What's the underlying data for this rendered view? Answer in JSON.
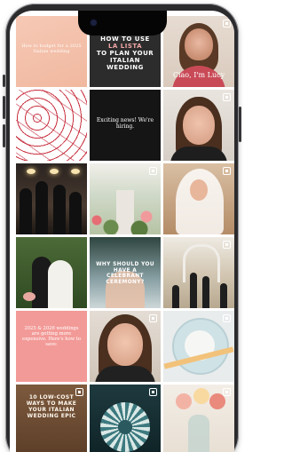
{
  "feed": {
    "posts": [
      {
        "overlay_text": "How to budget for a 2025 Italian wedding",
        "is_carousel": false
      },
      {
        "overlay_text_parts": [
          "HOW TO USE",
          "LA LISTA",
          "TO PLAN YOUR ITALIAN WEDDING"
        ],
        "is_carousel": true
      },
      {
        "overlay_text": "Ciao, I'm Lucy",
        "is_carousel": true
      },
      {
        "overlay_text": "",
        "is_carousel": false
      },
      {
        "overlay_text": "Exciting news! We're hiring.",
        "is_carousel": false
      },
      {
        "overlay_text": "",
        "is_carousel": true
      },
      {
        "overlay_text": "",
        "is_carousel": false
      },
      {
        "overlay_text": "",
        "is_carousel": true
      },
      {
        "overlay_text": "",
        "is_carousel": true
      },
      {
        "overlay_text": "",
        "is_carousel": false
      },
      {
        "overlay_text": "WHY SHOULD YOU HAVE A CELEBRANT CEREMONY?",
        "is_carousel": false
      },
      {
        "overlay_text": "",
        "is_carousel": true
      },
      {
        "overlay_text": "2025 & 2026 weddings are getting more expensive. Here's how to save:",
        "is_carousel": false
      },
      {
        "overlay_text": "",
        "is_carousel": true
      },
      {
        "overlay_text": "",
        "is_carousel": true
      },
      {
        "overlay_text": "10 LOW-COST WAYS TO MAKE YOUR ITALIAN WEDDING EPIC",
        "is_carousel": true
      },
      {
        "overlay_text": "",
        "is_carousel": true
      },
      {
        "overlay_text": "",
        "is_carousel": true
      }
    ]
  },
  "colors": {
    "peach": "#f1b89f",
    "dark": "#2c2c2c",
    "accent_pink": "#f2a7a7",
    "coral": "#f29a97",
    "phone_frame": "#2b2b2e"
  }
}
